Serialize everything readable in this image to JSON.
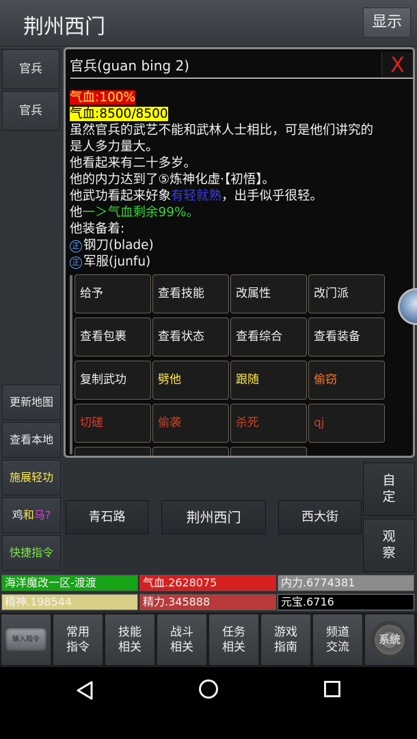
{
  "header": {
    "title": "荆州西门",
    "show_button": "显示"
  },
  "targets": [
    "官兵",
    "官兵"
  ],
  "panel": {
    "title": "官兵(guan bing 2)",
    "divider": "——————————————————————————————",
    "close": "X",
    "hp_pct": "气血:100%",
    "hp_val": "气血:8500/8500",
    "desc1": "虽然官兵的武艺不能和武林人士相比，可是他们讲究的",
    "desc2": "是人多力量大。",
    "age": "他看起来有二十多岁。",
    "neili": "他的内力达到了⑤炼神化虚·【初悟】。",
    "wugong_pre": "他武功看起来好象",
    "wugong_level": "有轻就熟",
    "wugong_post": "，出手似乎很轻。",
    "remain_pre": "他",
    "remain_green": "一＞气血剩余99%。",
    "equip_head": "他装备着:",
    "equip": [
      {
        "badge": "正",
        "name": "钢刀(blade)"
      },
      {
        "badge": "正",
        "name": "军服(junfu)"
      }
    ],
    "actions": [
      "给予",
      "查看技能",
      "改属性",
      "改门派",
      "查看包裹",
      "查看状态",
      "查看综合",
      "查看装备",
      "复制武功",
      "劈他",
      "跟随",
      "偷窃",
      "切磋",
      "偷袭",
      "杀死",
      "qj"
    ]
  },
  "side": {
    "update_map": "更新地图",
    "view_local": "查看本地",
    "qinggong": "施展轻功",
    "ji": "鸡",
    "he": "和",
    "ma": "马?",
    "quick": "快捷指令"
  },
  "roads": {
    "west": "青石路",
    "center": "荆州西门",
    "east": "西大街"
  },
  "right": {
    "custom": "自\n定",
    "observe": "观\n察"
  },
  "stats": {
    "server": "海洋魔改一区-渡渡",
    "qixue": "气血.2628075",
    "neili": "内力.6774381",
    "jingshen": "精神.198544",
    "jingli": "精力.345888",
    "yuanbao": "元宝.6716"
  },
  "toolbar": {
    "input_cmd": "输入指令",
    "common": "常用\n指令",
    "skills": "技能\n相关",
    "battle": "战斗\n相关",
    "tasks": "任务\n相关",
    "guide": "游戏\n指南",
    "channel": "频道\n交流",
    "settings": "系统"
  },
  "colors": {
    "hp_bar": "#d61f1f",
    "server_bar": "#16a316",
    "neili_bar": "#8c8c8c",
    "jingshen_bar": "#d8cf86",
    "jingli_bar": "#b83a3a",
    "yuanbao_bar": "#000000"
  }
}
